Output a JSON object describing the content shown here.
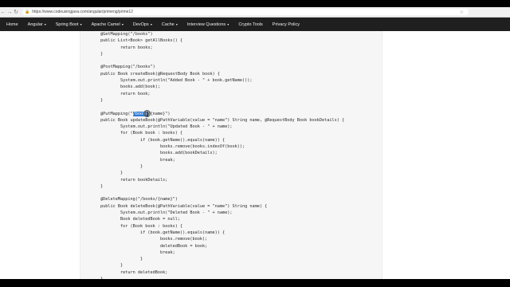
{
  "browser": {
    "url": "https://www.codeusingjava.com/angular/primeng/prime12"
  },
  "nav": {
    "items": [
      {
        "label": "Home",
        "has_caret": false
      },
      {
        "label": "Angular",
        "has_caret": true
      },
      {
        "label": "Spring Boot",
        "has_caret": true
      },
      {
        "label": "Apache Camel",
        "has_caret": true
      },
      {
        "label": "DevOps",
        "has_caret": true
      },
      {
        "label": "Cache",
        "has_caret": true
      },
      {
        "label": "Interview Questions",
        "has_caret": true
      },
      {
        "label": "Crypto Tools",
        "has_caret": false
      },
      {
        "label": "Privacy Policy",
        "has_caret": false
      }
    ]
  },
  "code": {
    "lines": [
      "@GetMapping(\"/books\")",
      "public List<Book> getAllBooks() {",
      "        return books;",
      "}",
      "",
      "@PostMapping(\"/books\")",
      "public Book createBook(@RequestBody Book book) {",
      "        System.out.println(\"Added Book - \" + book.getName());",
      "        books.add(book);",
      "        return book;",
      "}",
      "",
      "@PutMapping(\"/books/{name}\")",
      "public Book updateBook(@PathVariable(value = \"name\") String name, @RequestBody Book bookDetails) {",
      "        System.out.println(\"Updated Book - \" + name);",
      "        for (Book book : books) {",
      "                if (book.getName().equals(name)) {",
      "                        books.remove(books.indexOf(book));",
      "                        books.add(bookDetails);",
      "                        break;",
      "                }",
      "        }",
      "        return bookDetails;",
      "}",
      "",
      "@DeleteMapping(\"/books/{name}\")",
      "public Book deleteBook(@PathVariable(value = \"name\") String name) {",
      "        System.out.println(\"Deleted Book - \" + name);",
      "        Book deletedBook = null;",
      "        for (Book book : books) {",
      "                if (book.getName().equals(name)) {",
      "                        books.remove(book);",
      "                        deletedBook = book;",
      "                        break;",
      "                }",
      "        }",
      "        return deletedBook;",
      "}"
    ],
    "highlight": {
      "line_index": 12,
      "text": "/books"
    }
  }
}
